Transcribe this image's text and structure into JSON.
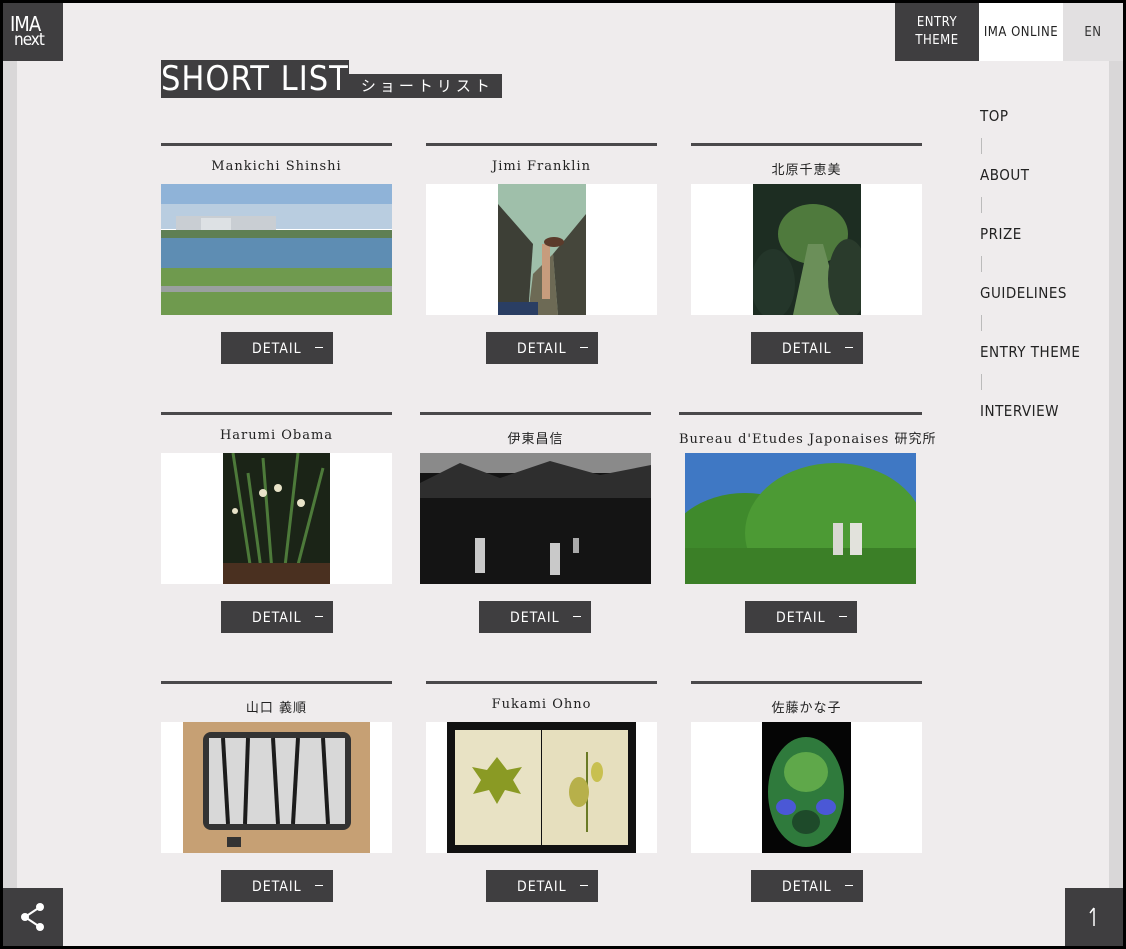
{
  "logo": {
    "line1": "IMA",
    "line2": "next"
  },
  "topnav": {
    "entry_theme": "ENTRY\nTHEME",
    "ima_online": "IMA ONLINE",
    "lang": "EN"
  },
  "title": {
    "main": "SHORT LIST",
    "sub": "ショートリスト"
  },
  "detail_label": "DETAIL",
  "entries": [
    {
      "name": "Mankichi Shinshi"
    },
    {
      "name": "Jimi Franklin"
    },
    {
      "name": "北原千恵美"
    },
    {
      "name": "Harumi Obama"
    },
    {
      "name": "伊東昌信"
    },
    {
      "name": "Bureau d'Etudes Japonaises 研究所"
    },
    {
      "name": "山口 義順"
    },
    {
      "name": "Fukami Ohno"
    },
    {
      "name": "佐藤かな子"
    }
  ],
  "sidenav": [
    "TOP",
    "ABOUT",
    "PRIZE",
    "GUIDELINES",
    "ENTRY THEME",
    "INTERVIEW"
  ],
  "icons": {
    "share": "share-icon",
    "totop": "arrow-up-icon"
  },
  "colors": {
    "dark": "#3f3e40",
    "bg": "#efeced"
  }
}
